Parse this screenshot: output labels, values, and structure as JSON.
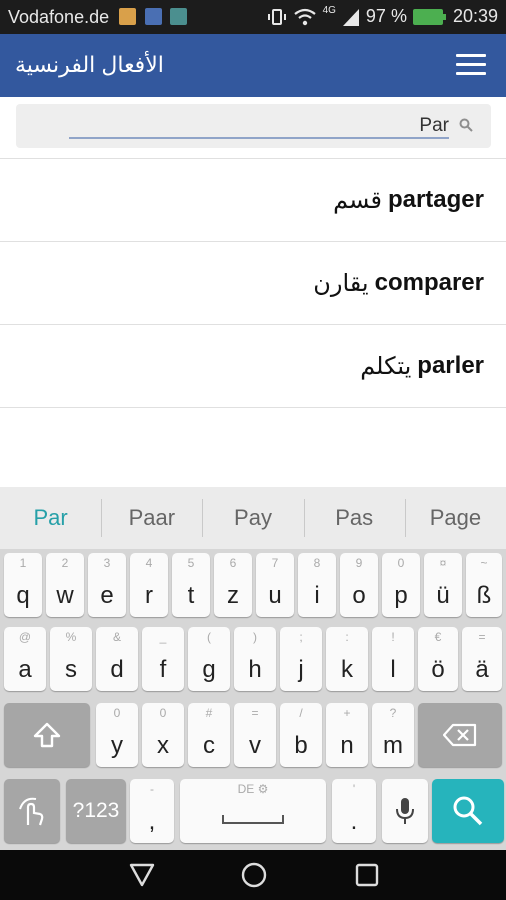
{
  "status_bar": {
    "carrier": "Vodafone.de",
    "network": "4G",
    "battery": "97 %",
    "time": "20:39",
    "battery_color": "#4caf50"
  },
  "app_bar": {
    "title": "الأفعال الفرنسية",
    "menu_icon": "hamburger-menu-icon",
    "color": "#33589e"
  },
  "search": {
    "value": "Par",
    "icon": "search-icon"
  },
  "results": [
    {
      "french": "partager",
      "arabic": "قسم"
    },
    {
      "french": "comparer",
      "arabic": "يقارن"
    },
    {
      "french": "parler",
      "arabic": "يتكلم"
    }
  ],
  "suggestions": [
    "Par",
    "Paar",
    "Pay",
    "Pas",
    "Page"
  ],
  "keyboard": {
    "accent_color": "#26b4bc",
    "row1": [
      {
        "k": "q",
        "h": "1"
      },
      {
        "k": "w",
        "h": "2"
      },
      {
        "k": "e",
        "h": "3"
      },
      {
        "k": "r",
        "h": "4"
      },
      {
        "k": "t",
        "h": "5"
      },
      {
        "k": "z",
        "h": "6"
      },
      {
        "k": "u",
        "h": "7"
      },
      {
        "k": "i",
        "h": "8"
      },
      {
        "k": "o",
        "h": "9"
      },
      {
        "k": "p",
        "h": "0"
      },
      {
        "k": "ü",
        "h": "¤"
      },
      {
        "k": "ß",
        "h": "~"
      }
    ],
    "row2": [
      {
        "k": "a",
        "h": "@"
      },
      {
        "k": "s",
        "h": "%"
      },
      {
        "k": "d",
        "h": "&"
      },
      {
        "k": "f",
        "h": "_"
      },
      {
        "k": "g",
        "h": "("
      },
      {
        "k": "h",
        "h": ")"
      },
      {
        "k": "j",
        "h": ";"
      },
      {
        "k": "k",
        "h": ":"
      },
      {
        "k": "l",
        "h": "!"
      },
      {
        "k": "ö",
        "h": "€"
      },
      {
        "k": "ä",
        "h": "="
      }
    ],
    "row3": [
      {
        "k": "y",
        "h": "0"
      },
      {
        "k": "x",
        "h": "0"
      },
      {
        "k": "c",
        "h": "#"
      },
      {
        "k": "v",
        "h": "="
      },
      {
        "k": "b",
        "h": "/"
      },
      {
        "k": "n",
        "h": "+"
      },
      {
        "k": "m",
        "h": "?"
      }
    ],
    "symbols_label": "?123",
    "comma_label": ",",
    "comma_hint": "-",
    "space_hint": "DE ⚙",
    "period_label": ".",
    "period_hint": "'",
    "shift_icon": "shift-icon",
    "backspace_icon": "backspace-icon",
    "gesture_icon": "gesture-icon",
    "mic_icon": "microphone-icon",
    "search_icon": "search-icon"
  },
  "nav_bar": {
    "back_icon": "back-triangle-icon",
    "home_icon": "home-circle-icon",
    "recents_icon": "recents-square-icon"
  }
}
